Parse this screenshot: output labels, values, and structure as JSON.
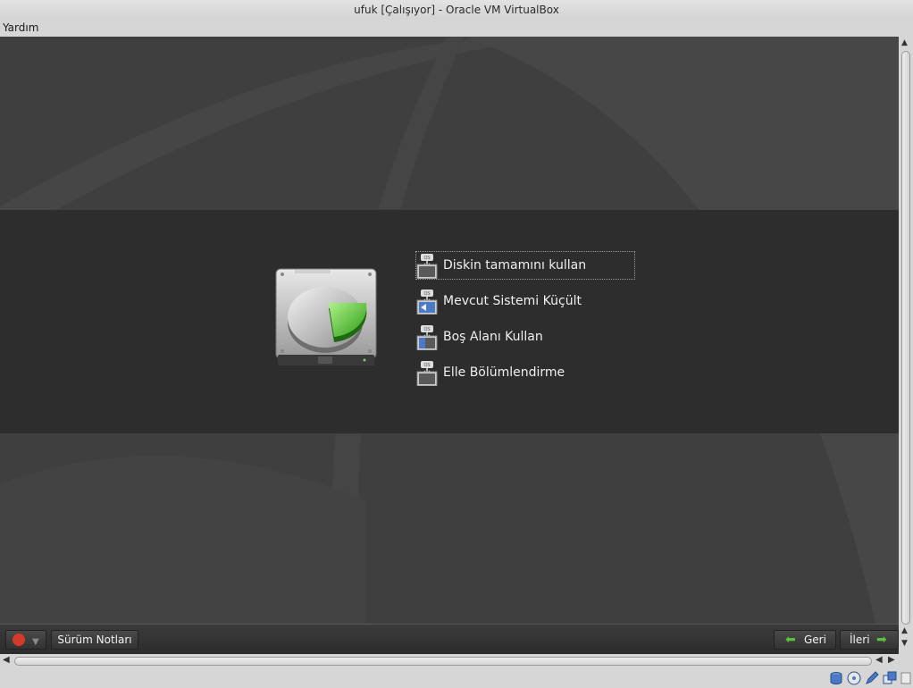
{
  "window": {
    "title": "ufuk [Çalışıyor] - Oracle VM VirtualBox"
  },
  "menubar": {
    "items": [
      {
        "label": "Yardım"
      }
    ]
  },
  "installer": {
    "options": [
      {
        "label": "Diskin tamamını kullan",
        "icon": "disk-full-icon",
        "focused": true
      },
      {
        "label": "Mevcut Sistemi Küçült",
        "icon": "disk-shrink-icon"
      },
      {
        "label": "Boş Alanı Kullan",
        "icon": "disk-free-icon"
      },
      {
        "label": "Elle Bölümlendirme",
        "icon": "disk-manual-icon"
      }
    ],
    "bottom": {
      "release_notes": "Sürüm Notları",
      "back": "Geri",
      "next": "İleri"
    }
  },
  "colors": {
    "accent_green": "#58c23a",
    "power_red": "#d23a2a",
    "vm_background": "#3f3f3f",
    "band": "#2d2d2d"
  },
  "statusbar": {
    "icons": [
      "hard-disk-icon",
      "cd-icon",
      "pencil-icon",
      "window-icon"
    ]
  }
}
